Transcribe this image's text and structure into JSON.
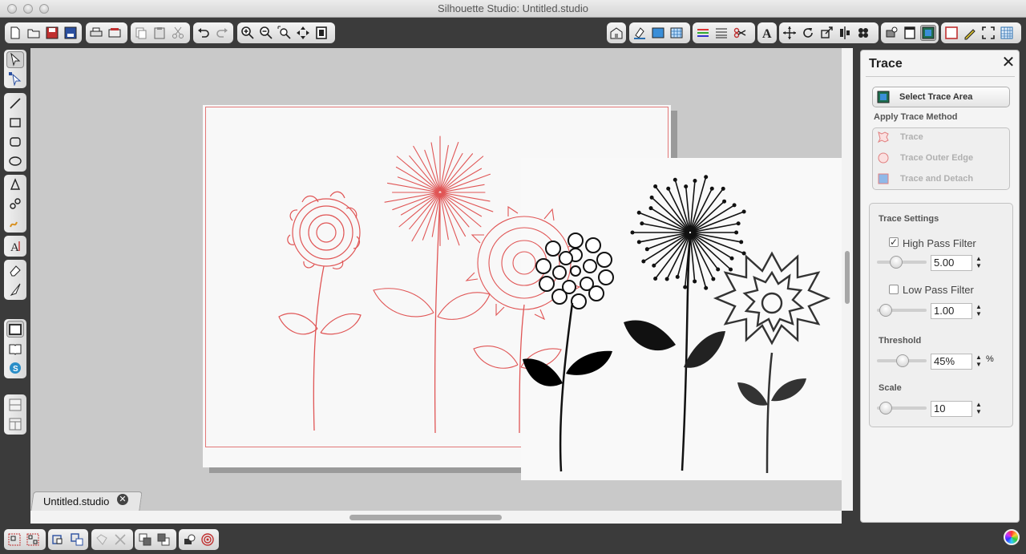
{
  "window": {
    "title": "Silhouette Studio: Untitled.studio"
  },
  "document_tab": {
    "label": "Untitled.studio",
    "close_glyph": "✕"
  },
  "toolbar": {
    "file_icons": [
      "new-document-icon",
      "open-folder-icon",
      "save-icon",
      "save-to-library-icon"
    ],
    "print_icons": [
      "print-icon",
      "send-to-cutter-icon"
    ],
    "clipboard_icons": [
      "copy-icon",
      "paste-icon",
      "cut-icon"
    ],
    "history_icons": [
      "undo-icon",
      "redo-icon"
    ],
    "zoom_icons": [
      "zoom-in-icon",
      "zoom-out-icon",
      "zoom-selection-icon",
      "pan-icon",
      "fit-to-page-icon"
    ],
    "right_icons": [
      "store-icon",
      "fill-color-icon",
      "fill-gradient-icon",
      "fill-pattern-icon",
      "line-color-icon",
      "line-style-icon",
      "cut-settings-icon",
      "text-style-icon",
      "transform-icon",
      "rotate-icon",
      "scale-icon",
      "align-icon",
      "replicate-icon",
      "offset-icon",
      "trace-icon",
      "page-setup-icon",
      "registration-icon",
      "sketch-icon",
      "fullscreen-icon",
      "grid-icon"
    ]
  },
  "left_tools": {
    "select_icons": [
      "select-tool-icon",
      "edit-points-icon"
    ],
    "draw_icons": [
      "line-tool-icon",
      "rectangle-tool-icon",
      "rounded-rectangle-tool-icon",
      "ellipse-tool-icon"
    ],
    "shape_icons": [
      "polygon-tool-icon",
      "curve-tool-icon",
      "freehand-tool-icon"
    ],
    "text_icons": [
      "text-tool-icon"
    ],
    "erase_icons": [
      "eraser-tool-icon",
      "knife-tool-icon"
    ],
    "library_icons": [
      "page-view-icon",
      "library-icon",
      "online-store-icon"
    ],
    "layout_icons": [
      "split-horizontal-icon",
      "split-vertical-icon"
    ]
  },
  "bottom_toolbar": {
    "group_icons": [
      "group-icon",
      "ungroup-icon"
    ],
    "compound_icons": [
      "make-compound-path-icon",
      "release-compound-path-icon"
    ],
    "merge_icons": [
      "weld-icon",
      "delete-icon"
    ],
    "arrange_icons": [
      "bring-to-front-icon",
      "send-to-back-icon"
    ],
    "misc_icons": [
      "fill-shape-icon",
      "target-icon"
    ]
  },
  "trace_panel": {
    "title": "Trace",
    "close_glyph": "✕",
    "select_area_label": "Select Trace Area",
    "apply_method_header": "Apply Trace Method",
    "methods": [
      {
        "label": "Trace",
        "icon": "trace-method-icon"
      },
      {
        "label": "Trace Outer Edge",
        "icon": "trace-outer-edge-icon"
      },
      {
        "label": "Trace and Detach",
        "icon": "trace-and-detach-icon"
      }
    ],
    "settings_header": "Trace Settings",
    "high_pass": {
      "label": "High Pass Filter",
      "checked": true,
      "value": "5.00",
      "slider_fraction": 0.3
    },
    "low_pass": {
      "label": "Low Pass Filter",
      "checked": false,
      "value": "1.00",
      "slider_fraction": 0.05
    },
    "threshold": {
      "label": "Threshold",
      "value": "45%",
      "unit": "%",
      "slider_fraction": 0.45
    },
    "scale": {
      "label": "Scale",
      "value": "10",
      "slider_fraction": 0.05
    }
  },
  "colors": {
    "trace_line": "#e05555",
    "accent": "#2a6fb0",
    "chrome": "#3b3b3b"
  }
}
